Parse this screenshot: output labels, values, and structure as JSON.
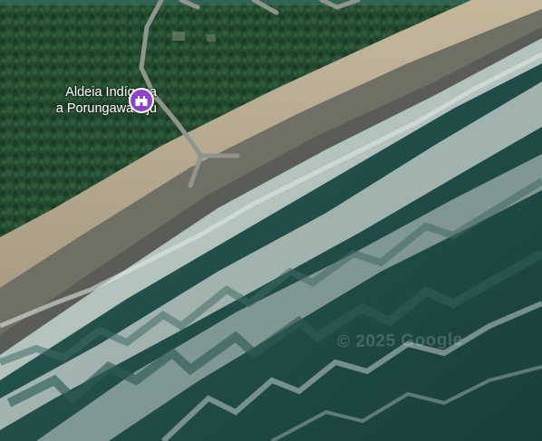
{
  "map": {
    "type": "satellite",
    "poi": {
      "name_line1": "Aldeia Indígena",
      "name_line2": "a Porungawa Dju",
      "icon": "landmark-pin-icon",
      "pin_color": "#8e44c9"
    },
    "watermark": "© 2025 Google",
    "colors": {
      "forest": "#234a2f",
      "forest_dark": "#17341f",
      "sand": "#b9ac93",
      "wet_sand": "#6e6e63",
      "surf": "#c9d3cf",
      "ocean": "#1f4f4a",
      "road": "#8d9189"
    }
  }
}
